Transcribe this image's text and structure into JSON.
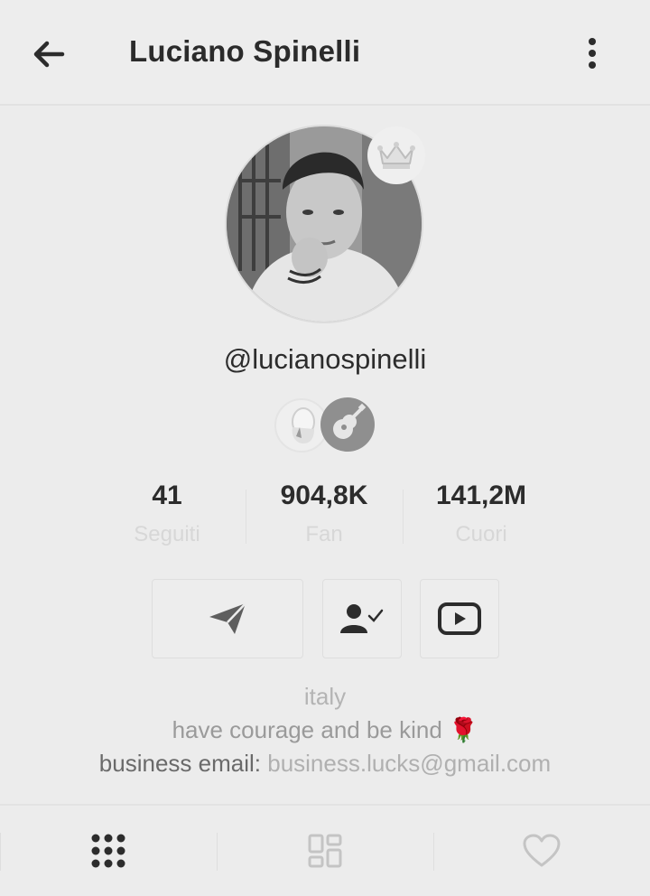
{
  "header": {
    "back_icon": "arrow-left-icon",
    "title": "Luciano Spinelli",
    "more_icon": "more-vertical-icon"
  },
  "profile": {
    "avatar_badge_icon": "crown-icon",
    "username": "@lucianospinelli",
    "badges": [
      "person-badge",
      "guitar-badge"
    ]
  },
  "stats": [
    {
      "value": "41",
      "label": "Seguiti"
    },
    {
      "value": "904,8K",
      "label": "Fan"
    },
    {
      "value": "141,2M",
      "label": "Cuori"
    }
  ],
  "actions": {
    "message_icon": "send-icon",
    "follow_icon": "user-check-icon",
    "youtube_icon": "youtube-icon"
  },
  "bio": {
    "location": "italy",
    "motto": "have courage and be kind 🌹",
    "email_label": "business email:",
    "email_value": "business.lucks@gmail.com"
  },
  "tabs": [
    "grid-icon",
    "collections-icon",
    "heart-icon"
  ]
}
